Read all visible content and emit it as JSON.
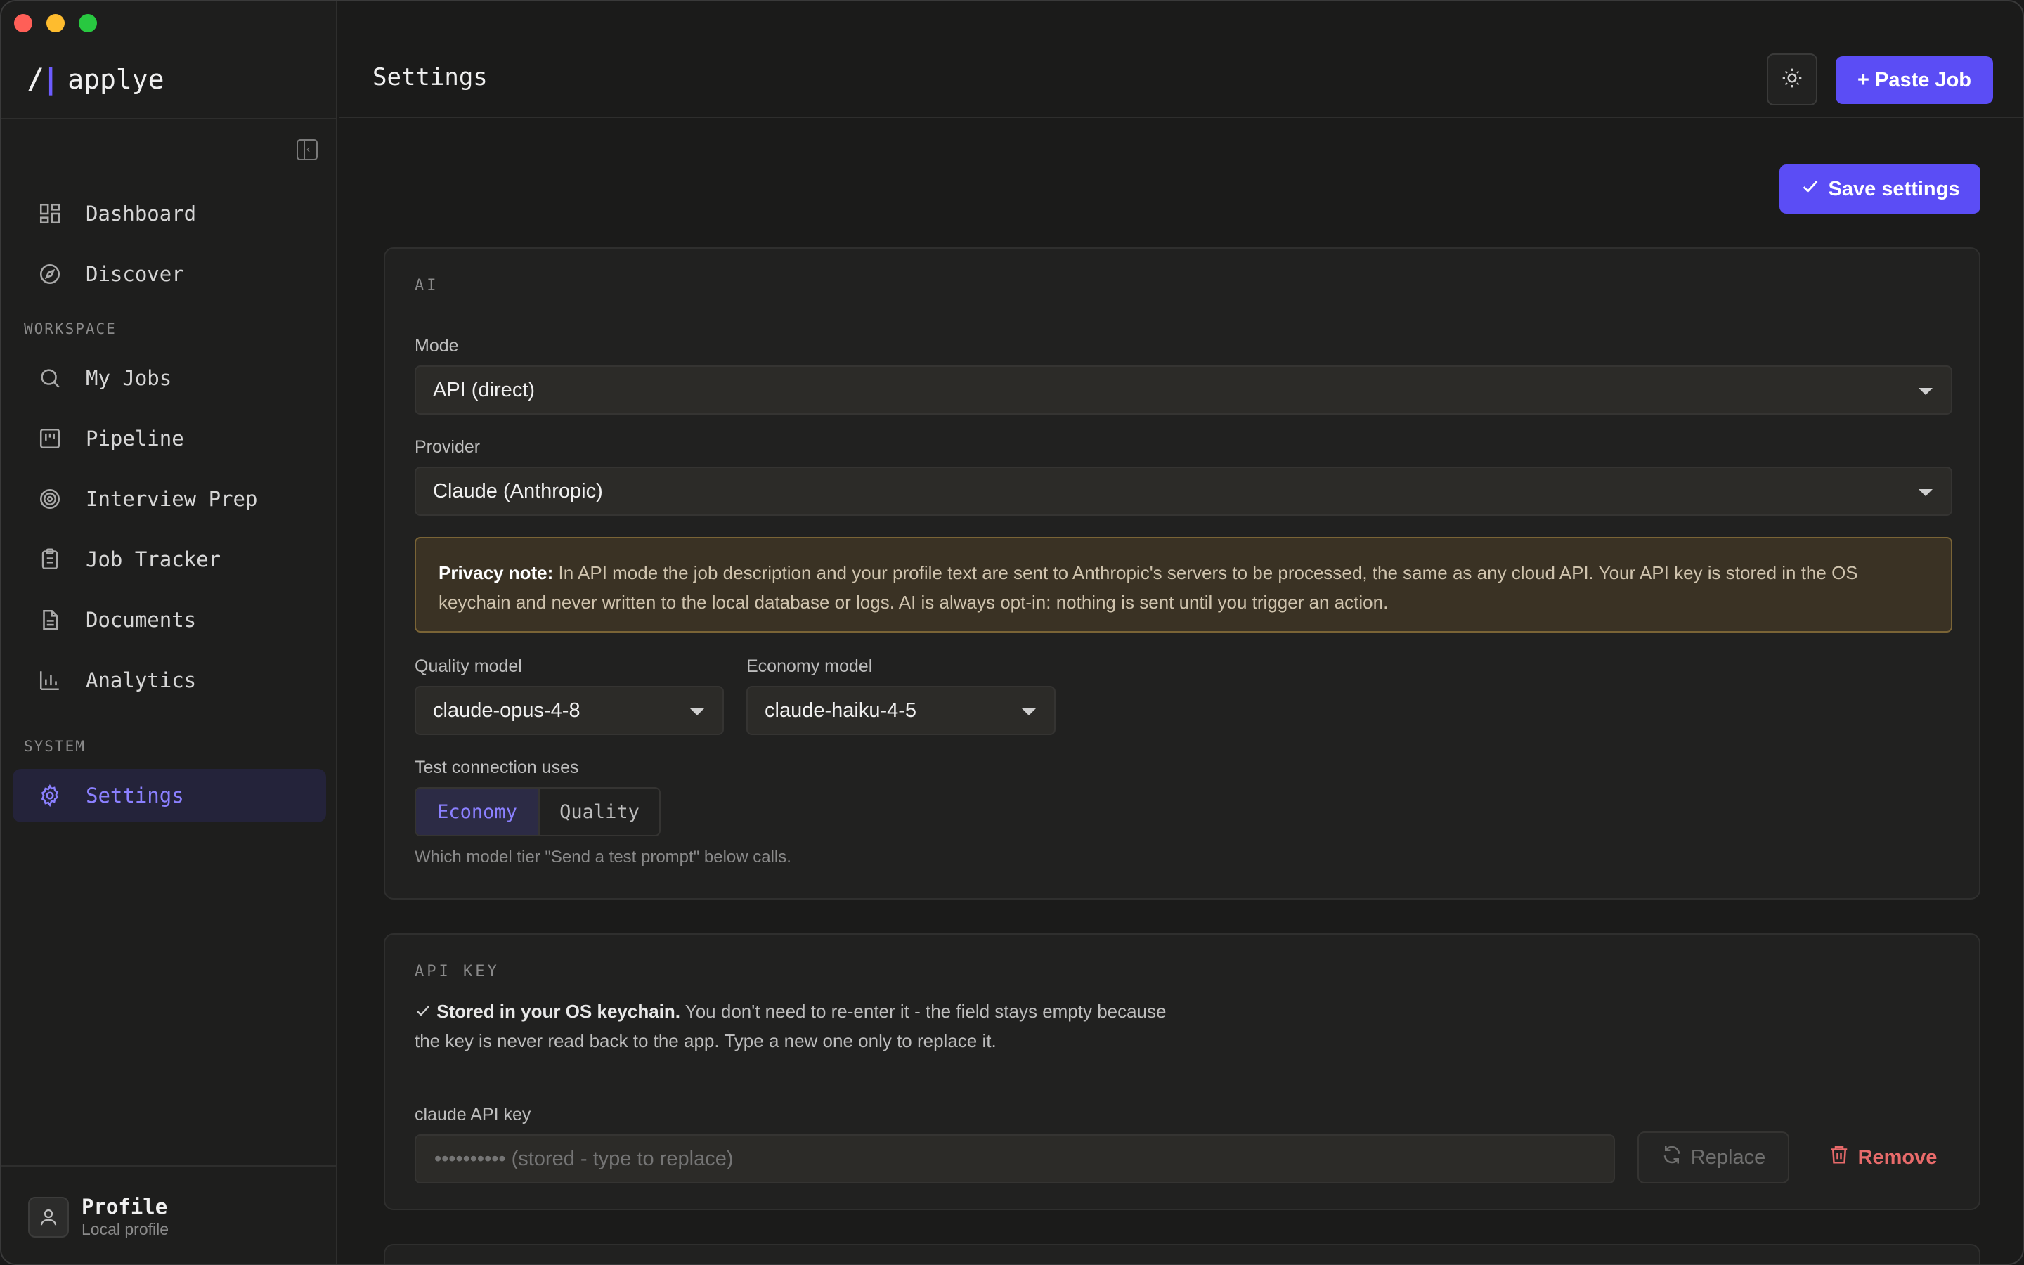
{
  "app": {
    "brand_mark_slash": "/",
    "brand_mark_bar": "|",
    "name": "applye"
  },
  "sidebar": {
    "items_top": [
      {
        "label": "Dashboard",
        "icon": "grid-icon"
      },
      {
        "label": "Discover",
        "icon": "compass-icon"
      }
    ],
    "workspace_label": "WORKSPACE",
    "workspace_items": [
      {
        "label": "My Jobs",
        "icon": "search-icon"
      },
      {
        "label": "Pipeline",
        "icon": "kanban-icon"
      },
      {
        "label": "Interview Prep",
        "icon": "target-icon"
      },
      {
        "label": "Job Tracker",
        "icon": "clipboard-icon"
      },
      {
        "label": "Documents",
        "icon": "document-icon"
      },
      {
        "label": "Analytics",
        "icon": "bar-chart-icon"
      }
    ],
    "system_label": "SYSTEM",
    "system_items": [
      {
        "label": "Settings",
        "icon": "gear-icon",
        "active": true
      }
    ],
    "profile": {
      "name": "Profile",
      "subtitle": "Local profile"
    }
  },
  "header": {
    "title": "Settings",
    "paste_job_label": "+ Paste Job"
  },
  "actions": {
    "save_label": "Save settings"
  },
  "ai_card": {
    "title": "AI",
    "mode_label": "Mode",
    "mode_value": "API (direct)",
    "provider_label": "Provider",
    "provider_value": "Claude (Anthropic)",
    "privacy_bold": "Privacy note:",
    "privacy_text": "In API mode the job description and your profile text are sent to Anthropic's servers to be processed, the same as any cloud API. Your API key is stored in the OS keychain and never written to the local database or logs. AI is always opt-in: nothing is sent until you trigger an action.",
    "quality_label": "Quality model",
    "quality_value": "claude-opus-4-8",
    "economy_label": "Economy model",
    "economy_value": "claude-haiku-4-5",
    "test_label": "Test connection uses",
    "test_options": [
      "Economy",
      "Quality"
    ],
    "test_selected": "Economy",
    "test_hint": "Which model tier \"Send a test prompt\" below calls."
  },
  "api_key_card": {
    "title": "API KEY",
    "stored_bold": "Stored in your OS keychain.",
    "stored_text": "You don't need to re-enter it - the field stays empty because the key is never read back to the app. Type a new one only to replace it.",
    "key_label": "claude API key",
    "key_placeholder": "•••••••••• (stored - type to replace)",
    "replace_label": "Replace",
    "remove_label": "Remove"
  },
  "colors": {
    "accent": "#5b4df5",
    "accent_text": "#8b80ff",
    "danger": "#e96b6b",
    "warning_bg": "#3a3224"
  }
}
